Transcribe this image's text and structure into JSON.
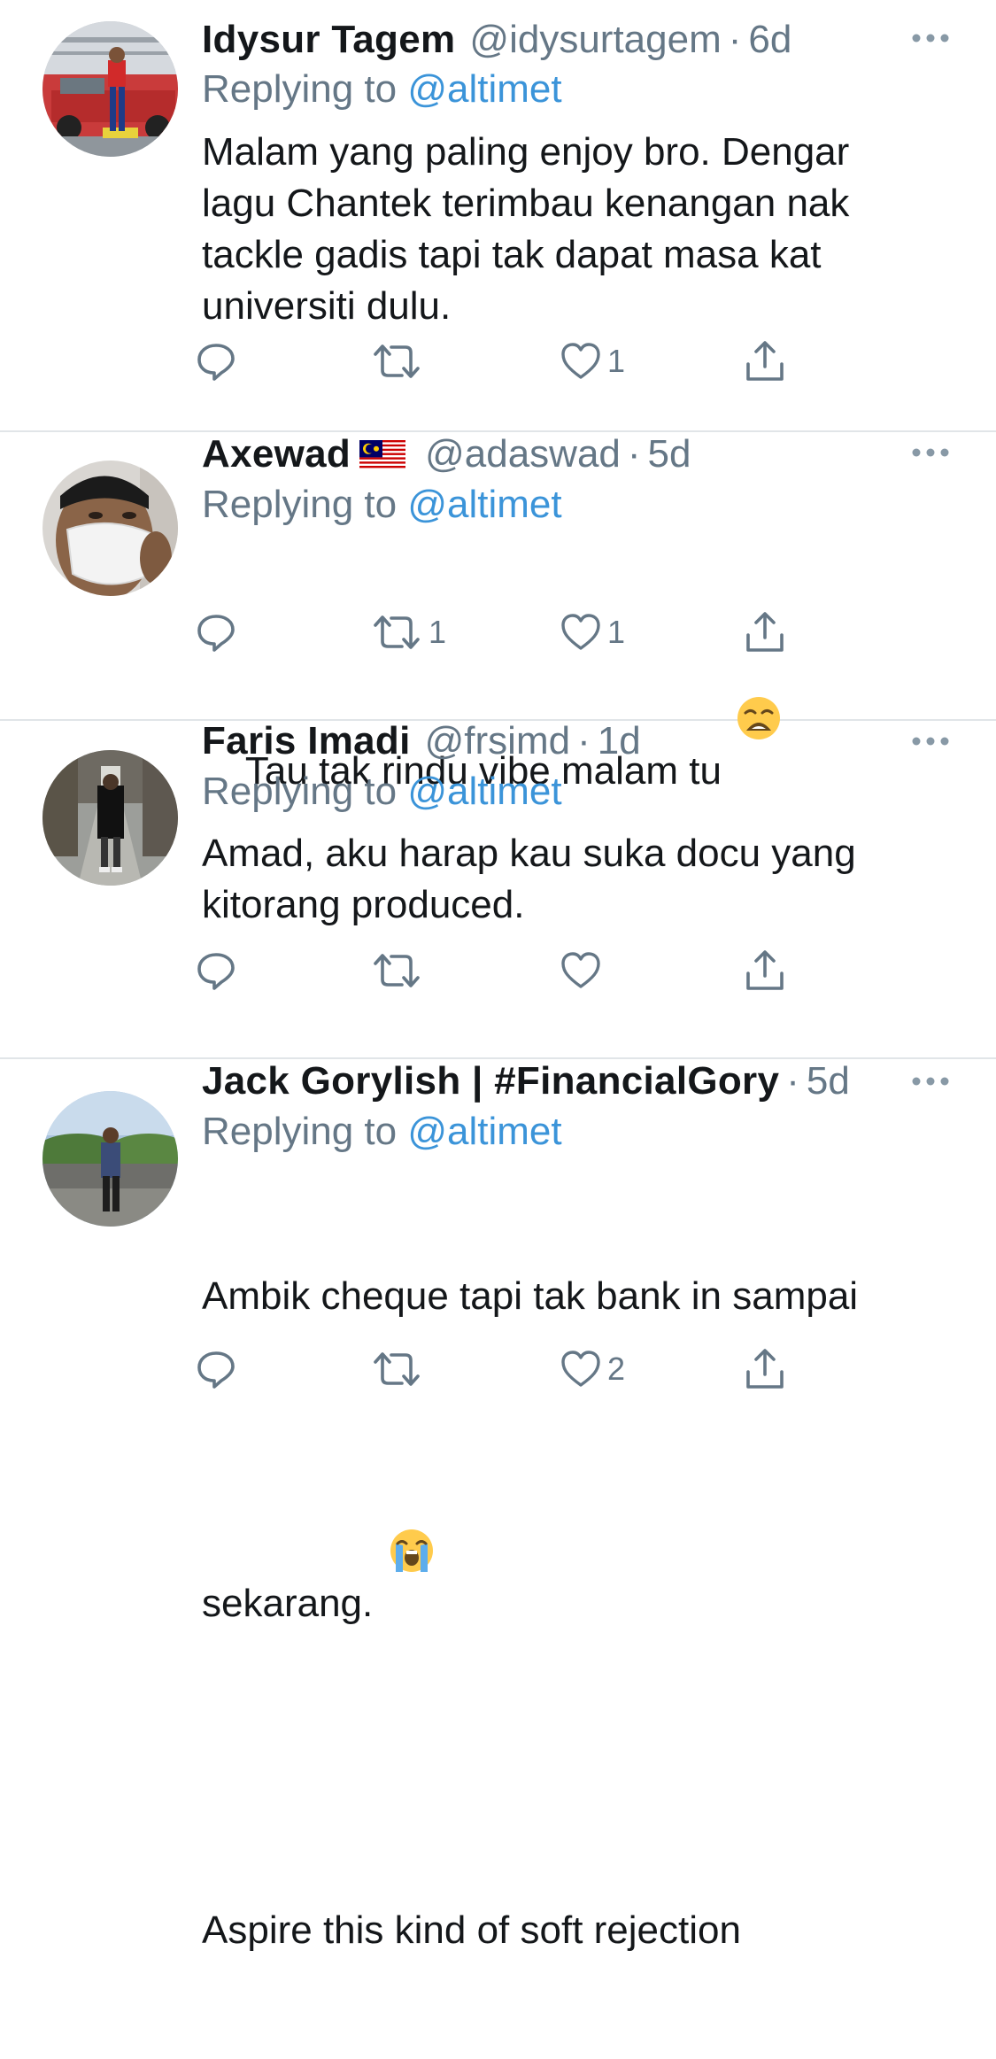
{
  "tweets": [
    {
      "name": "Idysur Tagem",
      "handle": "@idysurtagem",
      "time": "6d",
      "replying_prefix": "Replying to ",
      "replying_to": "@altimet",
      "text": "Malam yang paling enjoy bro. Dengar\nlagu Chantek terimbau kenangan nak\ntackle gadis tapi tak dapat masa kat\nuniversiti dulu.",
      "emoji": "",
      "retweets": "",
      "likes": "1"
    },
    {
      "name": "Axewad",
      "flag": "malaysia-flag",
      "handle": "@adaswad",
      "time": "5d",
      "replying_prefix": "Replying to ",
      "replying_to": "@altimet",
      "text": "Tau tak rindu vibe malam tu",
      "emoji": "weary-face",
      "retweets": "1",
      "likes": "1"
    },
    {
      "name": "Faris Imadi",
      "handle": "@frsimd",
      "time": "1d",
      "replying_prefix": "Replying to ",
      "replying_to": "@altimet",
      "text": "Amad, aku harap kau suka docu yang\nkitorang produced.",
      "emoji": "",
      "retweets": "",
      "likes": ""
    },
    {
      "name": "Jack Gorylish | #FinancialGory",
      "handle": "",
      "time": "5d",
      "replying_prefix": "Replying to ",
      "replying_to": "@altimet",
      "text_line1": "Ambik cheque tapi tak bank in sampai",
      "text_line2": "sekarang.",
      "emoji": "loudly-crying-face",
      "text_line3": "Aspire this kind of soft rejection",
      "retweets": "",
      "likes": "2"
    }
  ],
  "separator": "·",
  "icons": {
    "reply": "reply-icon",
    "retweet": "retweet-icon",
    "like": "heart-icon",
    "share": "share-icon",
    "more": "more-icon"
  },
  "colors": {
    "link": "#3b94d9",
    "muted": "#657786",
    "text": "#14171a",
    "divider": "#e1e5e8"
  }
}
